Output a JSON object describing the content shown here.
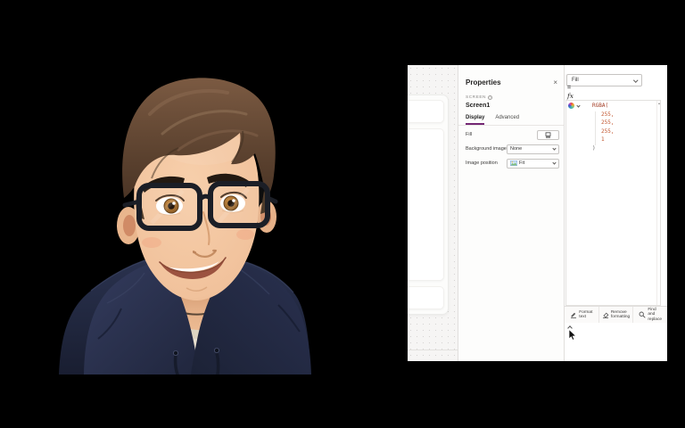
{
  "avatar": {
    "description": "3D cartoon man with glasses and navy hoodie"
  },
  "properties_panel": {
    "title": "Properties",
    "close_label": "×",
    "element_type_label": "SCREEN",
    "element_name": "Screen1",
    "accent_color": "#742774",
    "tabs": [
      {
        "label": "Display",
        "active": true
      },
      {
        "label": "Advanced",
        "active": false
      }
    ],
    "fields": [
      {
        "label": "Fill"
      },
      {
        "label": "Background image",
        "value": "None"
      },
      {
        "label": "Image position",
        "value": "Fit"
      }
    ]
  },
  "formula_bar": {
    "property_dropdown_value": "Fill",
    "equals_label": "=",
    "fx_label": "fx",
    "code": {
      "line1": "RGBA(",
      "line2": "255,",
      "line3": "255,",
      "line4": "255,",
      "line5": "1",
      "line6": ")"
    },
    "colors": {
      "function": "#a33b22",
      "number": "#c2562f",
      "paren": "#6a6a6a"
    },
    "footer": [
      {
        "label": "Format text"
      },
      {
        "label": "Remove formatting"
      },
      {
        "label": "Find and replace"
      }
    ]
  }
}
